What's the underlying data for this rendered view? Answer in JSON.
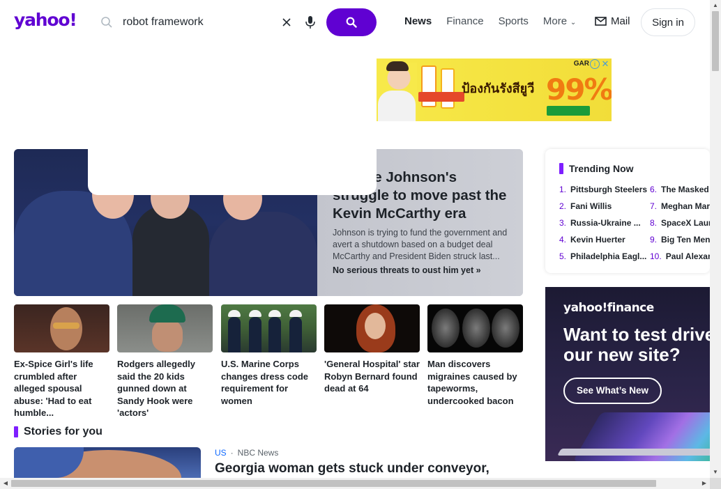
{
  "header": {
    "logo": "yahoo!",
    "search_value": "robot framework",
    "nav": [
      {
        "label": "News",
        "active": true
      },
      {
        "label": "Finance",
        "active": false
      },
      {
        "label": "Sports",
        "active": false
      },
      {
        "label": "More",
        "active": false
      }
    ],
    "mail_label": "Mail",
    "signin_label": "Sign in",
    "accent": "#6001d2"
  },
  "ad": {
    "headline": "ป้องกันรังสียูวี",
    "percent": "99%",
    "brand": "GAR"
  },
  "hero": {
    "title": "er Mike Johnson's struggle to move past the Kevin McCarthy era",
    "summary": "Johnson is trying to fund the government and avert a shutdown based on a budget deal McCarthy and President Biden struck last...",
    "link": "No serious threats to oust him yet »"
  },
  "stories": [
    {
      "caption": "Ex-Spice Girl's life crumbled after alleged spousal abuse: 'Had to eat humble..."
    },
    {
      "caption": "Rodgers allegedly said the 20 kids gunned down at Sandy Hook were 'actors'"
    },
    {
      "caption": "U.S. Marine Corps changes dress code requirement for women"
    },
    {
      "caption": "'General Hospital' star Robyn Bernard found dead at 64"
    },
    {
      "caption": "Man discovers migraines caused by tapeworms, undercooked bacon"
    }
  ],
  "stories_for_you": {
    "title": "Stories for you",
    "item": {
      "category": "US",
      "source": "NBC News",
      "headline": "Georgia woman gets stuck under conveyor,"
    }
  },
  "trending": {
    "title": "Trending Now",
    "items": [
      {
        "num": "1.",
        "label": "Pittsburgh Steelers"
      },
      {
        "num": "2.",
        "label": "Fani Willis"
      },
      {
        "num": "3.",
        "label": "Russia-Ukraine ..."
      },
      {
        "num": "4.",
        "label": "Kevin Huerter"
      },
      {
        "num": "5.",
        "label": "Philadelphia Eagl..."
      },
      {
        "num": "6.",
        "label": "The Masked"
      },
      {
        "num": "7.",
        "label": "Meghan Mar"
      },
      {
        "num": "8.",
        "label": "SpaceX Laun"
      },
      {
        "num": "9.",
        "label": "Big Ten Men'"
      },
      {
        "num": "10.",
        "label": "Paul Alexan"
      }
    ]
  },
  "finance_ad": {
    "logo": "yahoo!finance",
    "headline": "Want to test drive our new site?",
    "cta": "See What’s New"
  }
}
